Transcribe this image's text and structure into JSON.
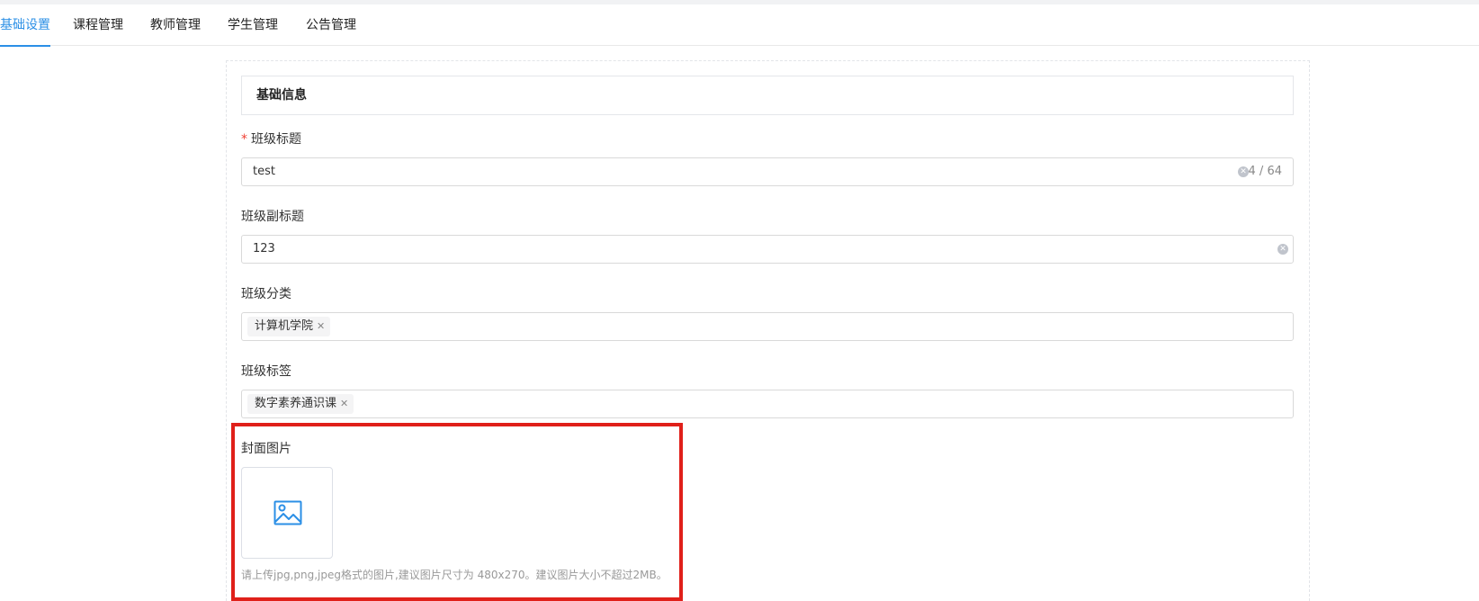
{
  "tabs": [
    {
      "label": "基础设置",
      "active": true
    },
    {
      "label": "课程管理",
      "active": false
    },
    {
      "label": "教师管理",
      "active": false
    },
    {
      "label": "学生管理",
      "active": false
    },
    {
      "label": "公告管理",
      "active": false
    }
  ],
  "section": {
    "title": "基础信息"
  },
  "form": {
    "title_field": {
      "label": "班级标题",
      "required": "*",
      "value": "test",
      "counter": "4 / 64"
    },
    "subtitle_field": {
      "label": "班级副标题",
      "value": "123"
    },
    "category_field": {
      "label": "班级分类",
      "tags": [
        "计算机学院"
      ]
    },
    "tag_field": {
      "label": "班级标签",
      "tags": [
        "数字素养通识课"
      ]
    },
    "cover_field": {
      "label": "封面图片",
      "upload_icon": "image-icon",
      "hint": "请上传jpg,png,jpeg格式的图片,建议图片尺寸为 480x270。建议图片大小不超过2MB。"
    }
  },
  "colors": {
    "accent": "#2b8fe6",
    "highlight": "#e0201a",
    "required": "#f04134"
  }
}
